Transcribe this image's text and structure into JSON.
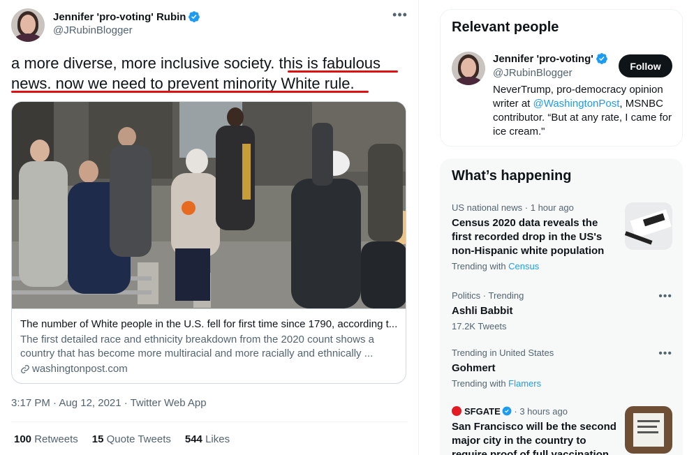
{
  "tweet": {
    "author_name": "Jennifer 'pro-voting' Rubin",
    "author_handle": "@JRubinBlogger",
    "text_part1": "a more diverse, more inclusive society. ",
    "text_highlight": "this is fabulous news. now we need to prevent minority White rule.",
    "card": {
      "title": "The number of White people in the U.S. fell for first time since 1790, according t...",
      "description": "The first detailed race and ethnicity breakdown from the 2020 count shows a country that has become more multiracial and more racially and ethnically ...",
      "domain": "washingtonpost.com"
    },
    "timestamp": "3:17 PM · Aug 12, 2021 · Twitter Web App",
    "stats": {
      "retweets_count": "100",
      "retweets_label": "Retweets",
      "quotes_count": "15",
      "quotes_label": "Quote Tweets",
      "likes_count": "544",
      "likes_label": "Likes"
    },
    "more_icon": "more-horizontal-icon",
    "highlight_color": "#dd1111"
  },
  "relevant_people": {
    "title": "Relevant people",
    "name": "Jennifer 'pro-voting'",
    "handle": "@JRubinBlogger",
    "follow_label": "Follow",
    "bio_part1": "NeverTrump, pro-democracy opinion writer at ",
    "bio_mention": "@WashingtonPost",
    "bio_part2": ", MSNBC contributor. “But at any rate, I came for ice cream.\""
  },
  "whats_happening": {
    "title": "What’s happening",
    "trends": [
      {
        "meta": "US national news · 1 hour ago",
        "title": "Census 2020 data reveals the first recorded drop in the US's non-Hispanic white population",
        "sub_prefix": "Trending with ",
        "sub_link": "Census"
      },
      {
        "meta": "Politics · Trending",
        "title": "Ashli Babbit",
        "sub": "17.2K Tweets"
      },
      {
        "meta": "Trending in United States",
        "title": "Gohmert",
        "sub_prefix": "Trending with ",
        "sub_link": "Flamers"
      },
      {
        "source": "SFGATE",
        "meta_suffix": " · 3 hours ago",
        "title": "San Francisco will be the second major city in the country to require proof of full vaccination"
      }
    ]
  },
  "colors": {
    "accent": "#1d9bf0",
    "text_primary": "#0f1419",
    "text_secondary": "#536471",
    "follow_bg": "#0f1419"
  }
}
